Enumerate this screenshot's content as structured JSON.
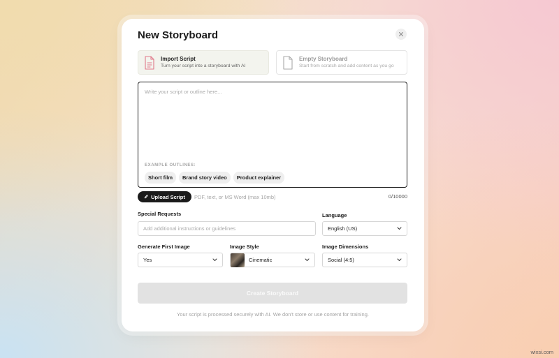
{
  "modal": {
    "title": "New Storyboard",
    "close_icon": "close-icon"
  },
  "modes": [
    {
      "title": "Import Script",
      "subtitle": "Turn your script into a storyboard with AI",
      "icon": "document-text-icon",
      "active": true,
      "accent": "#e0788a"
    },
    {
      "title": "Empty Storyboard",
      "subtitle": "Start from scratch and add content as you go",
      "icon": "document-blank-icon",
      "active": false
    }
  ],
  "script": {
    "placeholder": "Write your script or outline here...",
    "examples_label": "EXAMPLE OUTLINES:",
    "examples": [
      "Short film",
      "Brand story video",
      "Product explainer"
    ]
  },
  "upload": {
    "button_label": "Upload Script",
    "icon": "paperclip-icon",
    "hint": "PDF, text, or MS Word (max 10mb)",
    "char_count": "0/10000"
  },
  "fields": {
    "special_requests": {
      "label": "Special Requests",
      "placeholder": "Add additional instructions or guidelines"
    },
    "language": {
      "label": "Language",
      "value": "English (US)"
    },
    "generate_first_image": {
      "label": "Generate First Image",
      "value": "Yes"
    },
    "image_style": {
      "label": "Image Style",
      "value": "Cinematic"
    },
    "image_dimensions": {
      "label": "Image Dimensions",
      "value": "Social (4:5)"
    }
  },
  "actions": {
    "create_label": "Create Storyboard"
  },
  "footer": {
    "privacy_note": "Your script is processed securely with AI. We don't store or use content for training."
  },
  "watermark": "wixsi.com"
}
